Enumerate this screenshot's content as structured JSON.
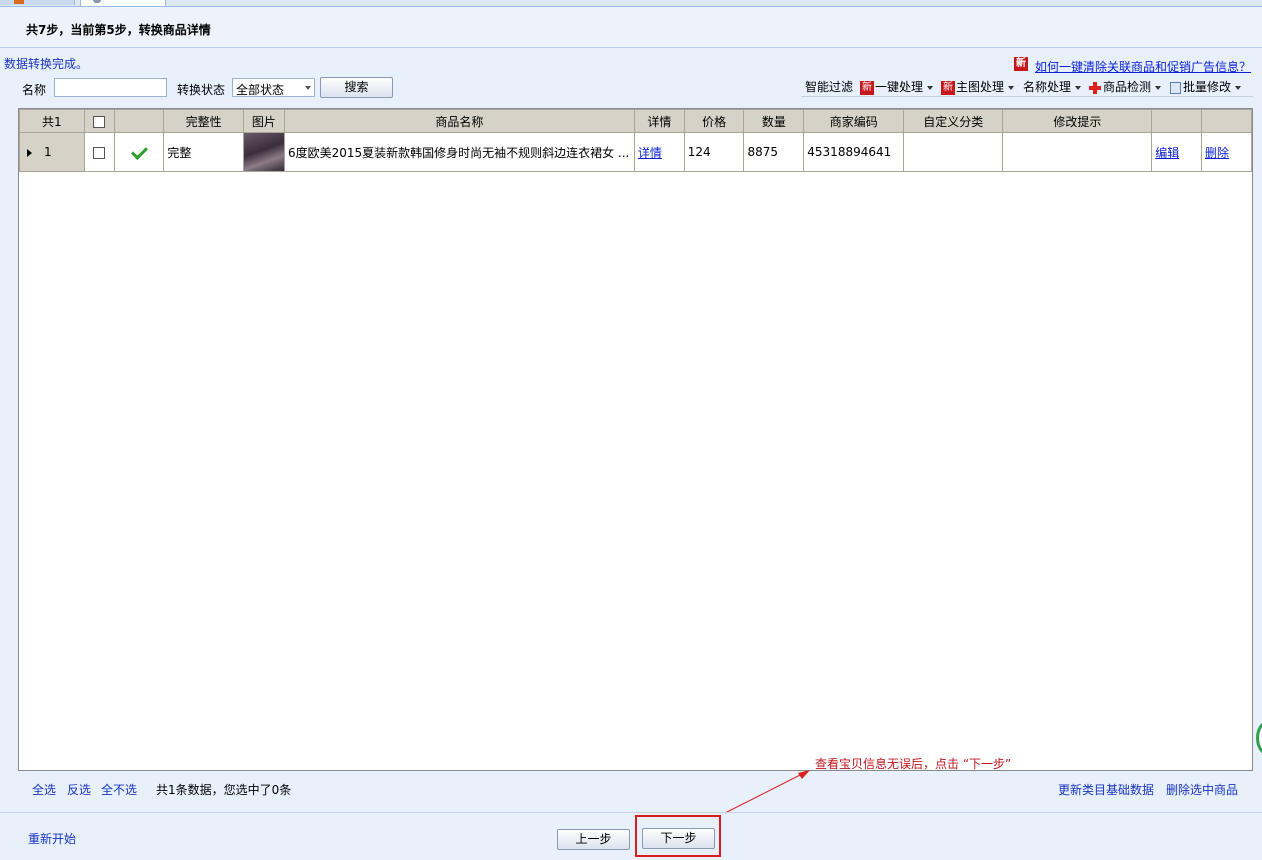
{
  "header": {
    "step_title": "共7步，当前第5步，转换商品详情"
  },
  "status": {
    "message": "数据转换完成。"
  },
  "help": {
    "badge": "新",
    "link": "如何一键清除关联商品和促销广告信息？"
  },
  "filter": {
    "name_label": "名称",
    "name_value": "",
    "state_label": "转换状态",
    "state_selected": "全部状态",
    "search_button": "搜索"
  },
  "toolbar": {
    "smart_filter": "智能过滤",
    "new_badge": "新",
    "one_click": "一键处理",
    "main_image": "主图处理",
    "name_process": "名称处理",
    "product_check": "商品检测",
    "batch_edit": "批量修改"
  },
  "grid": {
    "columns": [
      "共1",
      "",
      "",
      "完整性",
      "图片",
      "商品名称",
      "详情",
      "价格",
      "数量",
      "商家编码",
      "自定义分类",
      "修改提示",
      "",
      ""
    ],
    "rows": [
      {
        "index": "1",
        "completeness": "完整",
        "name": "6度欧美2015夏装新款韩国修身时尚无袖不规则斜边连衣裙女 ...",
        "detail": "详情",
        "price": "124",
        "quantity": "8875",
        "merchant_code": "45318894641",
        "custom_category": "",
        "hint": "",
        "edit": "编辑",
        "delete": "删除"
      }
    ]
  },
  "selection": {
    "select_all": "全选",
    "invert": "反选",
    "select_none": "全不选",
    "summary": "共1条数据，您选中了0条",
    "update_category": "更新类目基础数据",
    "delete_selected": "删除选中商品"
  },
  "annotation": "查看宝贝信息无误后，点击 “下一步”",
  "footer": {
    "restart": "重新开始",
    "prev": "上一步",
    "next": "下一步"
  }
}
